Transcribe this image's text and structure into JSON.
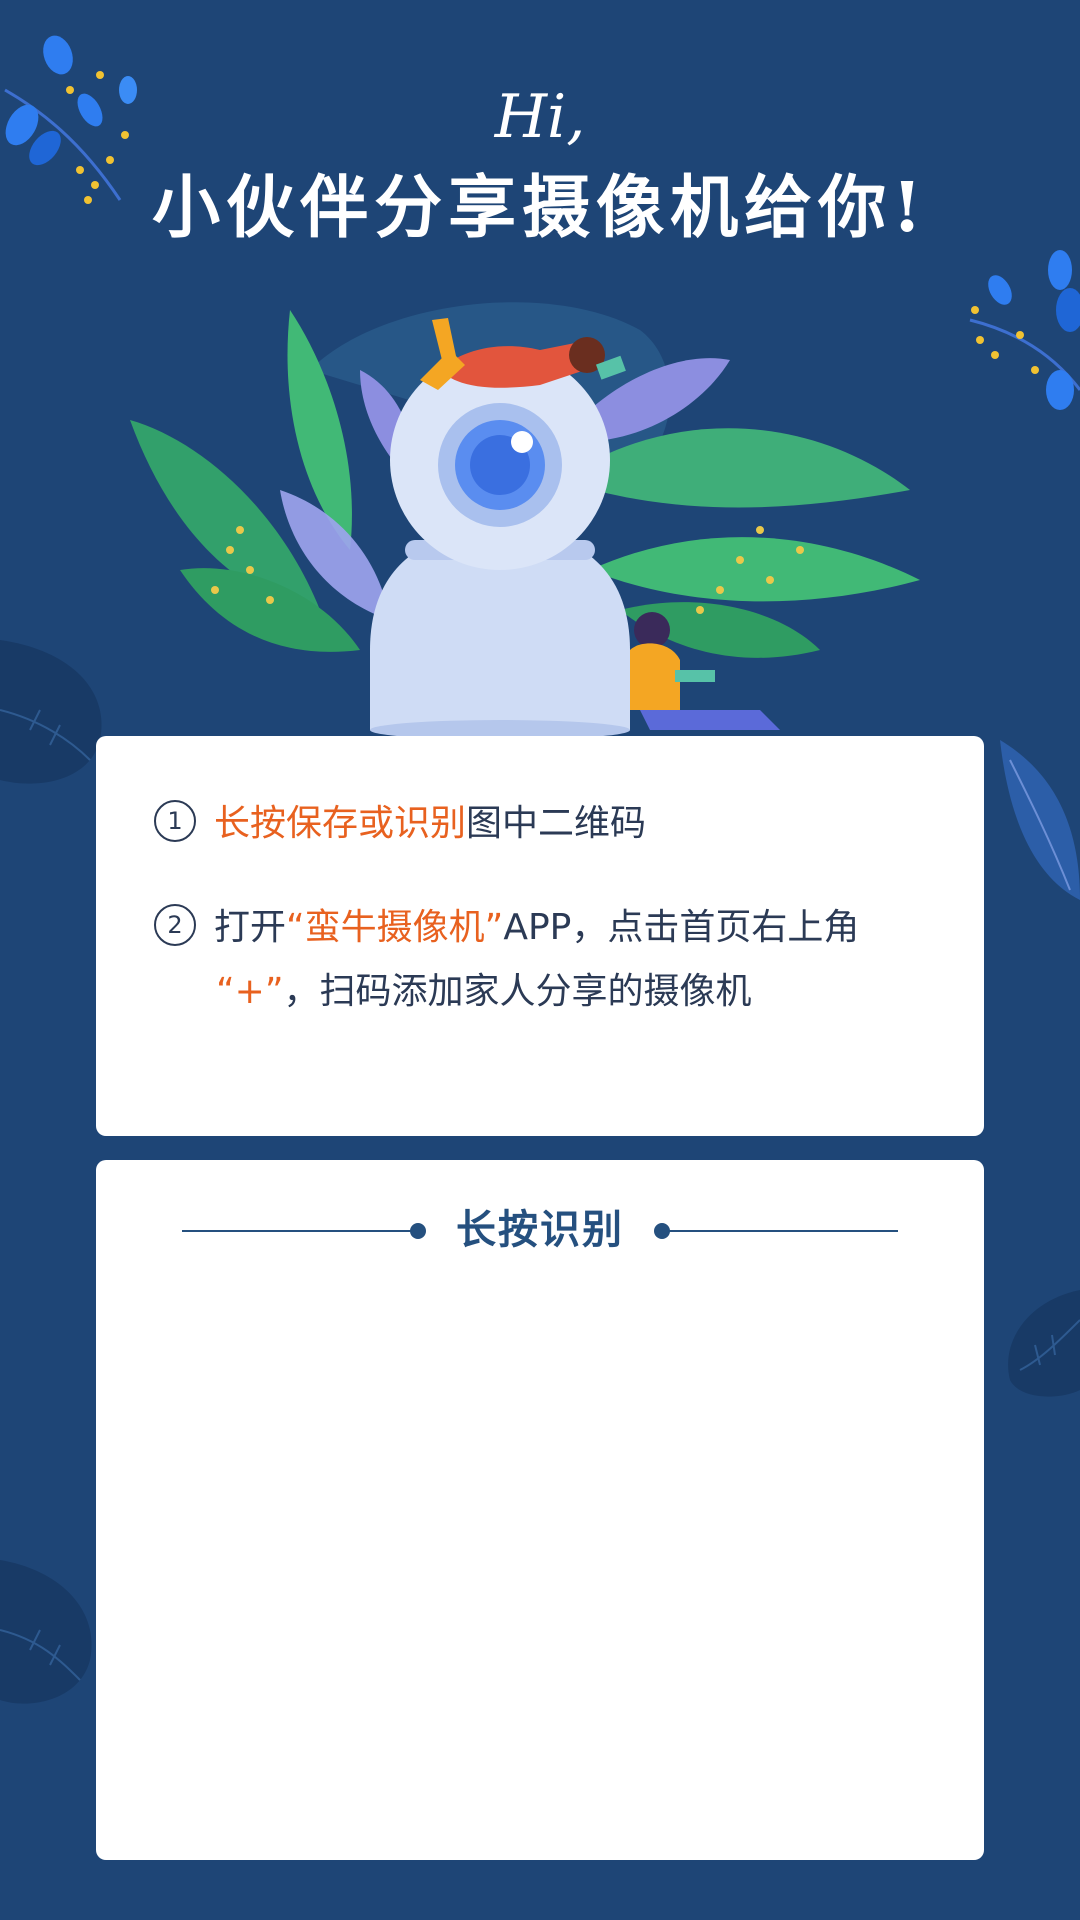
{
  "header": {
    "greeting": "Hi,",
    "title": "小伙伴分享摄像机给你!"
  },
  "instructions": {
    "step1": {
      "number": "1",
      "highlight": "长按保存或识别",
      "text": "图中二维码"
    },
    "step2": {
      "number": "2",
      "prefix": "打开",
      "highlight_app": "“蛮牛摄像机”",
      "middle": "APP，点击首页右上角",
      "highlight_plus": "“+”",
      "suffix": "，扫码添加家人分享的摄像机"
    }
  },
  "qr_section": {
    "title": "长按识别"
  },
  "colors": {
    "background": "#1e4576",
    "card": "#ffffff",
    "accent": "#e8611f",
    "text": "#2b3a55",
    "section_title": "#25507f"
  }
}
